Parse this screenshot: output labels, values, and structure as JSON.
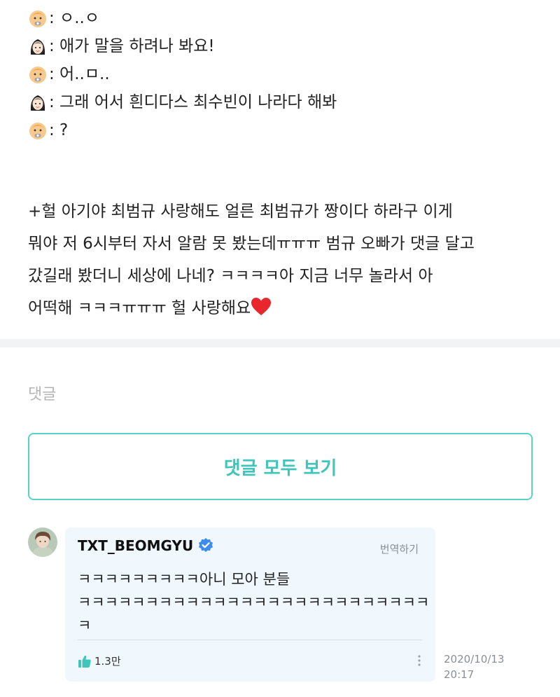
{
  "post": {
    "chat_lines": [
      {
        "speaker_icon": "baby-icon",
        "text": ": ㅇ..ㅇ"
      },
      {
        "speaker_icon": "woman-icon",
        "text": ": 애가 말을 하려나 봐요!"
      },
      {
        "speaker_icon": "baby-icon",
        "text": ": 어..ㅁ.."
      },
      {
        "speaker_icon": "woman-icon",
        "text": ": 그래 어서 흰디다스 최수빈이 나라다 해봐"
      },
      {
        "speaker_icon": "baby-icon",
        "text": ": ?"
      }
    ],
    "extra_lines": [
      "+헐 아기야 최범규 사랑해도 얼른 최범규가 짱이다 하라구 이게",
      "뭐야 저 6시부터 자서 알람 못 봤는데ㅠㅠㅠ 범규 오빠가 댓글 달고",
      "갔길래 봤더니 세상에 나네? ㅋㅋㅋㅋ아 지금 너무 놀라서 아",
      "어떡해 ㅋㅋㅋㅠㅠㅠ 헐 사랑해요"
    ],
    "heart_icon": "red-heart-icon"
  },
  "comments": {
    "title": "댓글",
    "view_all_label": "댓글 모두 보기",
    "accent_color": "#3fc5b9",
    "items": [
      {
        "author": "TXT_BEOMGYU",
        "verified": true,
        "translate_label": "번역하기",
        "text_lines": [
          "ㅋㅋㅋㅋㅋㅋㅋㅋㅋ아니 모아 분들",
          "ㅋㅋㅋㅋㅋㅋㅋㅋㅋㅋㅋㅋㅋㅋㅋㅋㅋㅋㅋㅋㅋㅋㅋㅋㅋㅋ",
          "ㅋ"
        ],
        "likes": "1.3만",
        "date": "2020/10/13",
        "time": "20:17"
      }
    ]
  }
}
